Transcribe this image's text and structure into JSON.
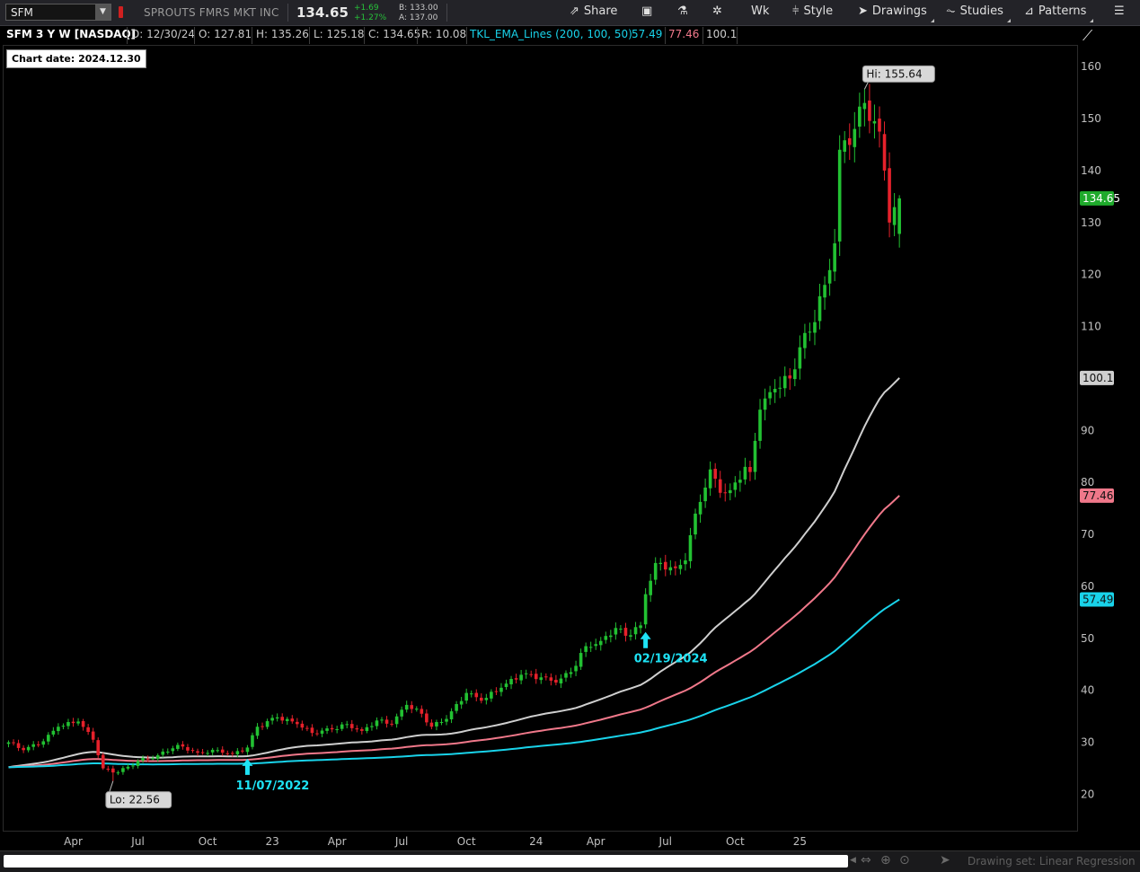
{
  "toolbar": {
    "symbol": "SFM",
    "company": "SPROUTS FMRS MKT INC",
    "last": "134.65",
    "net_change": "+1.69",
    "pct_change": "+1.27%",
    "bid": "B: 133.00",
    "ask": "A: 137.00",
    "share_label": "Share",
    "timeframe_label": "Wk",
    "style_label": "Style",
    "drawings_label": "Drawings",
    "studies_label": "Studies",
    "patterns_label": "Patterns"
  },
  "infobar": {
    "symbol_desc": "SFM 3 Y W [NASDAQ]",
    "date": "D: 12/30/24",
    "open": "O: 127.81",
    "high": "H: 135.26",
    "low": "L: 125.18",
    "close": "C: 134.65",
    "range": "R: 10.08",
    "study_name": "TKL_EMA_Lines (200, 100, 50)",
    "ema200": "57.49",
    "ema100": "77.46",
    "ema50": "100.1"
  },
  "chart_date_label": "Chart date:  2024.12.30",
  "colors": {
    "up": "#22c132",
    "down": "#e6212b",
    "ema50": "#cfcfcf",
    "ema100": "#f0788a",
    "ema200": "#19d3ea",
    "annotation": "#1ee3f5"
  },
  "chart_data": {
    "type": "candlestick",
    "timeframe": "weekly",
    "period": "3 years",
    "ylim": [
      13,
      164
    ],
    "y_ticks": [
      20,
      30,
      40,
      50,
      60,
      70,
      80,
      90,
      110,
      120,
      130,
      140,
      150,
      160
    ],
    "x_tick_labels": [
      "Apr",
      "Jul",
      "Oct",
      "23",
      "Apr",
      "Jul",
      "Oct",
      "24",
      "Apr",
      "Jul",
      "Oct",
      "25"
    ],
    "price_labels": {
      "last": "134.65",
      "ema50": "100.1",
      "ema100": "77.46",
      "ema200": "57.49"
    },
    "high_label": "Hi: 155.64",
    "low_label": "Lo: 22.56",
    "anchors": [
      {
        "week": 0,
        "price": 30
      },
      {
        "week": 3,
        "price": 28.5
      },
      {
        "week": 7,
        "price": 30.2
      },
      {
        "week": 10,
        "price": 33
      },
      {
        "week": 14,
        "price": 34
      },
      {
        "week": 17,
        "price": 30.5
      },
      {
        "week": 19,
        "price": 25
      },
      {
        "week": 22,
        "price": 24.2
      },
      {
        "week": 26,
        "price": 26.4
      },
      {
        "week": 30,
        "price": 27.5
      },
      {
        "week": 34,
        "price": 29.5
      },
      {
        "week": 38,
        "price": 28
      },
      {
        "week": 42,
        "price": 28.5
      },
      {
        "week": 45,
        "price": 27.8
      },
      {
        "week": 48,
        "price": 29
      },
      {
        "week": 50,
        "price": 33
      },
      {
        "week": 54,
        "price": 34.8
      },
      {
        "week": 58,
        "price": 33.5
      },
      {
        "week": 61,
        "price": 31.8
      },
      {
        "week": 65,
        "price": 32.5
      },
      {
        "week": 68,
        "price": 33.5
      },
      {
        "week": 71,
        "price": 32.2
      },
      {
        "week": 74,
        "price": 34.2
      },
      {
        "week": 77,
        "price": 33.5
      },
      {
        "week": 80,
        "price": 37.2
      },
      {
        "week": 83,
        "price": 35.5
      },
      {
        "week": 85,
        "price": 33
      },
      {
        "week": 88,
        "price": 34.5
      },
      {
        "week": 92,
        "price": 39.5
      },
      {
        "week": 95,
        "price": 38
      },
      {
        "week": 99,
        "price": 40.5
      },
      {
        "week": 103,
        "price": 43
      },
      {
        "week": 107,
        "price": 42.5
      },
      {
        "week": 110,
        "price": 41.5
      },
      {
        "week": 113,
        "price": 43.5
      },
      {
        "week": 116,
        "price": 48.5
      },
      {
        "week": 119,
        "price": 49.5
      },
      {
        "week": 122,
        "price": 52
      },
      {
        "week": 124,
        "price": 50.5
      },
      {
        "week": 127,
        "price": 52.5
      },
      {
        "week": 128,
        "price": 58.5
      },
      {
        "week": 130,
        "price": 64.5
      },
      {
        "week": 134,
        "price": 63.5
      },
      {
        "week": 136,
        "price": 65
      },
      {
        "week": 138,
        "price": 74
      },
      {
        "week": 141,
        "price": 82.5
      },
      {
        "week": 143,
        "price": 78
      },
      {
        "week": 145,
        "price": 78.5
      },
      {
        "week": 148,
        "price": 83
      },
      {
        "week": 149,
        "price": 82
      },
      {
        "week": 150,
        "price": 88
      },
      {
        "week": 151,
        "price": 94
      },
      {
        "week": 154,
        "price": 98
      },
      {
        "week": 157,
        "price": 100
      },
      {
        "week": 159,
        "price": 106
      },
      {
        "week": 161,
        "price": 109
      },
      {
        "week": 164,
        "price": 118
      },
      {
        "week": 166,
        "price": 126
      },
      {
        "week": 167,
        "price": 144
      },
      {
        "week": 170,
        "price": 148
      },
      {
        "week": 172,
        "price": 153
      },
      {
        "week": 174,
        "price": 149.5
      },
      {
        "week": 175,
        "price": 147.5
      },
      {
        "week": 176,
        "price": 140
      },
      {
        "week": 177,
        "price": 130
      },
      {
        "week": 178,
        "price": 132.96
      },
      {
        "week": 179,
        "price": 134.65
      }
    ],
    "ema_series": [
      {
        "name": "EMA 50",
        "period": 50,
        "last": 100.1
      },
      {
        "name": "EMA 100",
        "period": 100,
        "last": 77.46
      },
      {
        "name": "EMA 200",
        "period": 200,
        "last": 57.49
      }
    ],
    "annotations": [
      {
        "label": "11/07/2022",
        "week": 48
      },
      {
        "label": "02/19/2024",
        "week": 128
      }
    ],
    "last_bar": {
      "date": "12/30/24",
      "open": 127.81,
      "high": 135.26,
      "low": 125.18,
      "close": 134.65
    },
    "high": 155.64,
    "low": 22.56
  },
  "status": {
    "drawing_set": "Drawing set: Linear Regression"
  }
}
